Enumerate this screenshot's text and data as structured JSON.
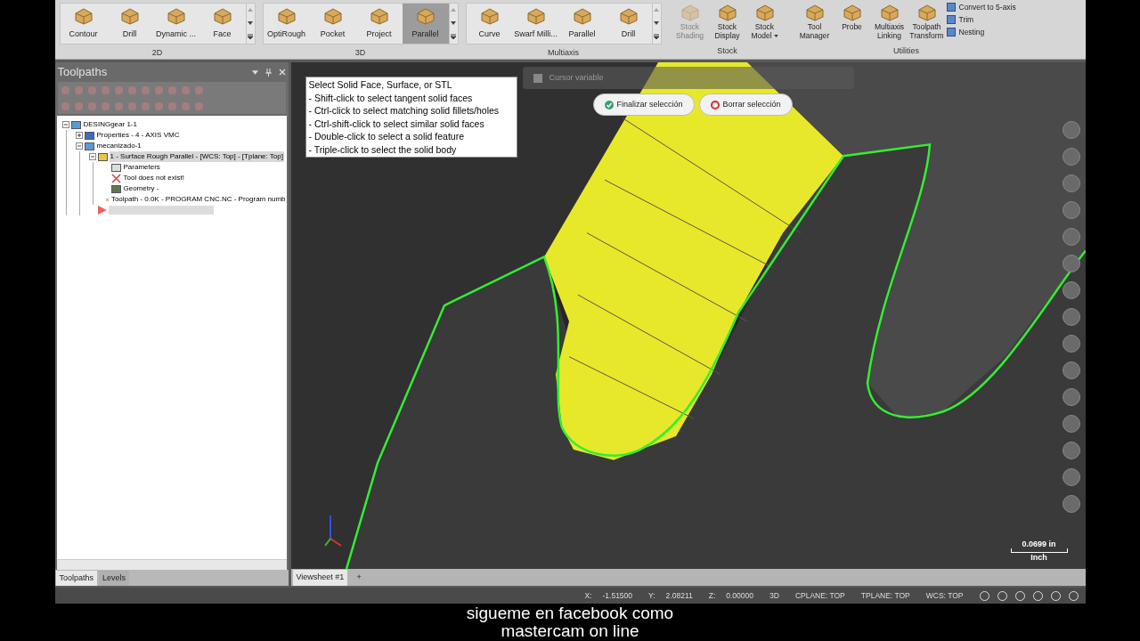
{
  "ribbon": {
    "groups": [
      {
        "label": "2D",
        "kind": "gallery",
        "buttons": [
          {
            "label": "Contour",
            "selected": false
          },
          {
            "label": "Drill",
            "selected": false
          },
          {
            "label": "Dynamic ...",
            "selected": false
          },
          {
            "label": "Face",
            "selected": false
          }
        ]
      },
      {
        "label": "3D",
        "kind": "gallery",
        "buttons": [
          {
            "label": "OptiRough",
            "selected": false
          },
          {
            "label": "Pocket",
            "selected": false
          },
          {
            "label": "Project",
            "selected": false
          },
          {
            "label": "Parallel",
            "selected": true
          }
        ]
      },
      {
        "label": "Multiaxis",
        "kind": "gallery",
        "buttons": [
          {
            "label": "Curve",
            "selected": false
          },
          {
            "label": "Swarf Milli...",
            "selected": false
          },
          {
            "label": "Parallel",
            "selected": false
          },
          {
            "label": "Drill",
            "selected": false
          }
        ]
      },
      {
        "label": "Stock",
        "kind": "plain",
        "buttons": [
          {
            "label": "Stock Shading",
            "disabled": true,
            "dropdown": false
          },
          {
            "label": "Stock Display",
            "disabled": false,
            "dropdown": false
          },
          {
            "label": "Stock Model",
            "disabled": false,
            "dropdown": true
          }
        ]
      },
      {
        "label": "Utilities",
        "kind": "plain",
        "buttons": [
          {
            "label": "Tool Manager",
            "disabled": false,
            "dropdown": false
          },
          {
            "label": "Probe",
            "disabled": false,
            "dropdown": false
          },
          {
            "label": "Multiaxis Linking",
            "disabled": false,
            "dropdown": false
          },
          {
            "label": "Toolpath Transform",
            "disabled": false,
            "dropdown": false
          }
        ],
        "small_buttons": [
          "Convert to 5-axis",
          "Trim",
          "Nesting"
        ]
      }
    ]
  },
  "panel": {
    "title": "Toolpaths",
    "tree": [
      {
        "label": "DESINGgear 1-1",
        "kind": "machine-group",
        "expanded": true,
        "selected": false,
        "children": [
          {
            "label": "Properties - 4 - AXIS VMC",
            "kind": "properties",
            "expanded": false,
            "selected": false
          },
          {
            "label": "mecanizado-1",
            "kind": "toolpath-group",
            "expanded": true,
            "selected": false,
            "children": [
              {
                "label": "1 - Surface Rough Parallel - [WCS: Top] - [Tplane: Top]",
                "kind": "operation",
                "expanded": true,
                "selected": true,
                "children": [
                  {
                    "label": "Parameters",
                    "kind": "parameters",
                    "selected": false
                  },
                  {
                    "label": "Tool does not exist!",
                    "kind": "tool-error",
                    "selected": false
                  },
                  {
                    "label": "Geometry -",
                    "kind": "geometry",
                    "selected": false
                  },
                  {
                    "label": "Toolpath - 0.0K - PROGRAM CNC.NC - Program numb",
                    "kind": "toolpath-error",
                    "selected": false
                  }
                ]
              },
              {
                "kind": "insert-marker",
                "selected": false
              }
            ]
          }
        ]
      }
    ],
    "tabs": [
      {
        "label": "Toolpaths",
        "selected": true
      },
      {
        "label": "Levels",
        "selected": false
      }
    ]
  },
  "viewport": {
    "cursor_toolbar": "Cursor variable",
    "hint": [
      "Select Solid Face, Surface, or STL",
      "- Shift-click to select tangent solid faces",
      "- Ctrl-click to select matching solid fillets/holes",
      "- Ctrl-shift-click to select similar solid faces",
      "- Double-click to select a solid feature",
      "- Triple-click to select the solid body"
    ],
    "buttons": [
      {
        "label": "Finalizar selección",
        "kind": "confirm"
      },
      {
        "label": "Borrar selección",
        "kind": "clear"
      }
    ],
    "scale": {
      "value": "0.0699 in",
      "unit": "Inch"
    }
  },
  "viewsheets": {
    "tabs": [
      {
        "label": "Viewsheet #1",
        "selected": true
      }
    ],
    "add": "+"
  },
  "status_bar": {
    "coordinates": [
      {
        "axis": "X:",
        "value": "-1.51500"
      },
      {
        "axis": "Y:",
        "value": "2.08211"
      },
      {
        "axis": "Z:",
        "value": "0.00000"
      }
    ],
    "views": [
      "3D",
      "CPLANE: TOP",
      "TPLANE: TOP",
      "WCS: TOP"
    ]
  },
  "subtitle": [
    "sigueme en facebook como",
    "mastercam on line"
  ]
}
